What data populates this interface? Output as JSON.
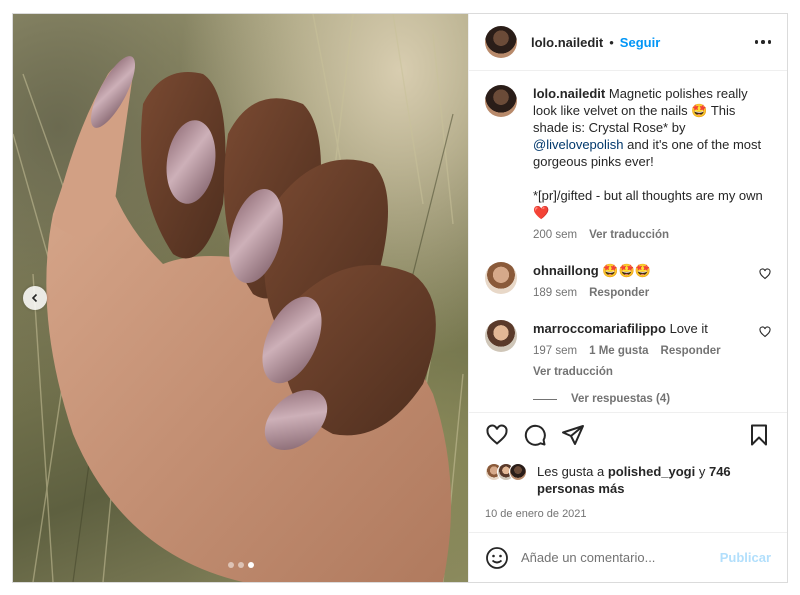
{
  "post": {
    "username": "lolo.nailedit",
    "separator": "•",
    "follow_label": "Seguir"
  },
  "caption": {
    "username": "lolo.nailedit",
    "text_1": "Magnetic polishes really look like velvet on the nails 🤩 This shade is: Crystal Rose* by ",
    "mention": "@livelovepolish",
    "text_2": " and it's one of the most gorgeous pinks ever!",
    "text_3": "*[pr]/gifted - but all thoughts are my own ❤️",
    "time": "200 sem",
    "translate": "Ver traducción"
  },
  "comments": [
    {
      "username": "ohnaillong",
      "text": "🤩🤩🤩",
      "time": "189 sem",
      "reply": "Responder"
    },
    {
      "username": "marroccomariafilippo",
      "text": "Love it",
      "time": "197 sem",
      "likes": "1 Me gusta",
      "reply": "Responder",
      "translate": "Ver traducción"
    }
  ],
  "view_replies": "Ver respuestas (4)",
  "likes": {
    "prefix": "Les gusta a ",
    "user": "polished_yogi",
    "mid": " y ",
    "count": "746",
    "suffix": " personas más"
  },
  "date": "10 de enero de 2021",
  "comment_input": {
    "placeholder": "Añade un comentario...",
    "publish": "Publicar"
  },
  "carousel": {
    "slides": 3,
    "active": 2
  },
  "icons": [
    "chevron-left-icon",
    "more-icon",
    "heart-icon",
    "comment-icon",
    "share-icon",
    "bookmark-icon",
    "emoji-icon"
  ]
}
